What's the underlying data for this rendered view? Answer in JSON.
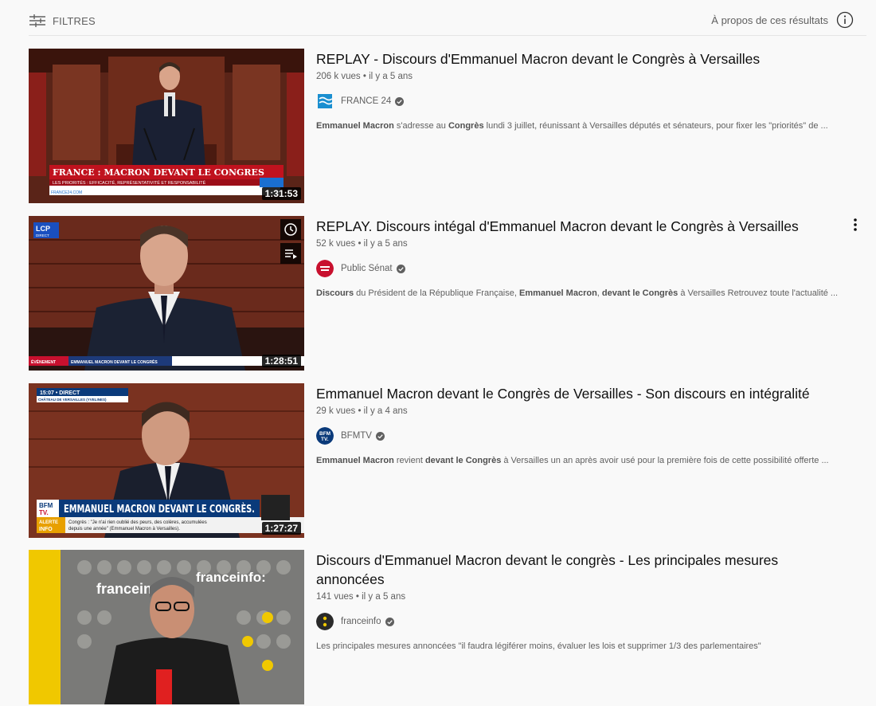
{
  "filters": {
    "label": "FILTRES"
  },
  "about": {
    "label": "À propos de ces résultats"
  },
  "results": [
    {
      "title": "REPLAY - Discours d'Emmanuel Macron devant le Congrès à Versailles",
      "views": "206 k vues",
      "age": "il y a 5 ans",
      "channel": "FRANCE 24",
      "duration": "1:31:53",
      "thumb_text": {
        "banner": "FRANCE : MACRON DEVANT LE CONGRES",
        "sub": "LES PRIORITÉS : EFFICACITÉ, REPRÉSENTATIVITÉ ET RESPONSABILITÉ",
        "site": "FRANCE24.COM"
      },
      "desc": [
        {
          "t": "Emmanuel Macron",
          "b": true
        },
        {
          "t": " s'adresse au ",
          "b": false
        },
        {
          "t": "Congrès",
          "b": true
        },
        {
          "t": " lundi 3 juillet, réunissant à Versailles députés et sénateurs, pour fixer les \"priorités\" de ...",
          "b": false
        }
      ]
    },
    {
      "title": "REPLAY. Discours intégal d'Emmanuel Macron devant le Congrès à Versailles",
      "views": "52 k vues",
      "age": "il y a 5 ans",
      "channel": "Public Sénat",
      "duration": "1:28:51",
      "thumb_text": {
        "logo": "LCP",
        "logo_sub": "DIRECT",
        "event": "ÉVÉNEMENT",
        "banner": "EMMANUEL MACRON DEVANT LE CONGRÈS"
      },
      "desc": [
        {
          "t": "Discours",
          "b": true
        },
        {
          "t": " du Président de la République Française, ",
          "b": false
        },
        {
          "t": "Emmanuel Macron",
          "b": true
        },
        {
          "t": ", ",
          "b": false
        },
        {
          "t": "devant le Congrès",
          "b": true
        },
        {
          "t": " à Versailles Retrouvez toute l'actualité ...",
          "b": false
        }
      ]
    },
    {
      "title": "Emmanuel Macron devant le Congrès de Versailles - Son discours en intégralité",
      "views": "29 k vues",
      "age": "il y a 4 ans",
      "channel": "BFMTV",
      "duration": "1:27:27",
      "thumb_text": {
        "live": "15:07 • DIRECT",
        "place": "CHÂTEAU DE VERSAILLES (YVELINES)",
        "banner": "EMMANUEL MACRON DEVANT LE CONGRÈS.",
        "alert1": "ALERTE",
        "alert2": "INFO",
        "ticker1": "Congrès : \"Je n'ai rien oublié des peurs, des colères, accumulées",
        "ticker2": "depuis une année\" (Emmanuel Macron à Versailles)."
      },
      "desc": [
        {
          "t": "Emmanuel Macron",
          "b": true
        },
        {
          "t": " revient ",
          "b": false
        },
        {
          "t": "devant le Congrès",
          "b": true
        },
        {
          "t": " à Versailles un an après avoir usé pour la première fois de cette possibilité offerte ...",
          "b": false
        }
      ]
    },
    {
      "title": "Discours d'Emmanuel Macron devant le congrès - Les principales mesures annoncées",
      "views": "141 vues",
      "age": "il y a 5 ans",
      "channel": "franceinfo",
      "duration": "",
      "thumb_text": {
        "brand": "franceinfo:",
        "brand2": "francein"
      },
      "desc": [
        {
          "t": "Les principales mesures annoncées \"il faudra légiférer moins, évaluer les lois et supprimer 1/3 des parlementaires\"",
          "b": false
        }
      ]
    }
  ],
  "colors": {
    "france24": "#1a8fd0",
    "publicsenat": "#c8102e",
    "bfmtv": "#0a3a7a",
    "franceinfo": "#e8c000"
  }
}
